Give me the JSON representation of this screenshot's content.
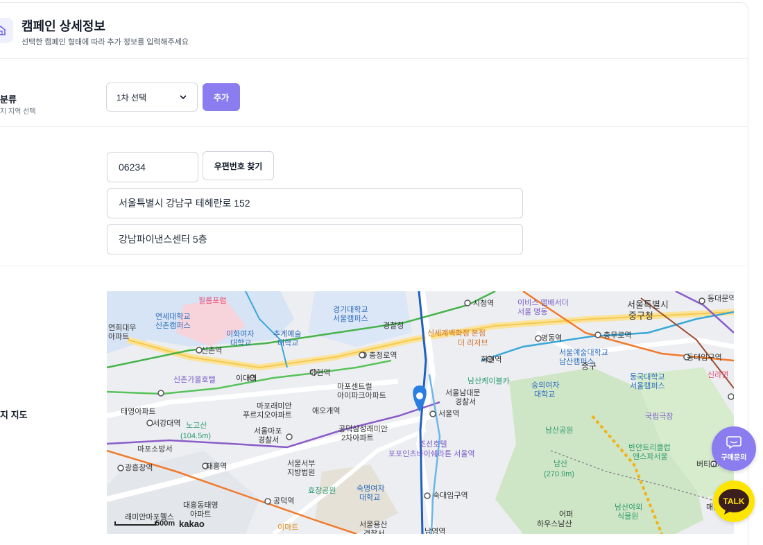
{
  "header": {
    "title": "캠페인 상세정보",
    "subtitle": "선택한 캠페인 형태에 따라 추가 정보를 입력해주세요"
  },
  "region": {
    "label": "분류",
    "hint": "지 지역 선택",
    "select_value": "1차 선택",
    "add_label": "추가"
  },
  "address": {
    "postcode": "06234",
    "find_postcode_label": "우편번호 찾기",
    "address1": "서울특별시 강남구 테헤란로 152",
    "address2": "강남파이낸스센터 5층"
  },
  "map": {
    "label": "지 지도",
    "attribution": "kakao",
    "scale_label": "500m",
    "places": [
      "필름포럼",
      "연세대학교 신촌캠퍼스",
      "이화여자 대학교",
      "추계예술 대학교",
      "경기대학교 서울캠퍼스",
      "경찰청",
      "시청역",
      "이비스 앰배서더 서울 명동",
      "서울특별시 중구청",
      "동대문역",
      "연희대우 아파트",
      "신촌역",
      "충정로역",
      "신세계백화점 본점 더 리저브",
      "명동역",
      "충무로역",
      "서울예술대학교 남산캠퍼스",
      "동대입구역",
      "중구",
      "신촌가올호텔",
      "이대역",
      "아현역",
      "마포센트럴 아이파크아파트",
      "회현역",
      "남산케이블카",
      "숭의여자 대학교",
      "동국대학교 서울캠퍼스",
      "신라면",
      "태영아파트",
      "서강대역",
      "노고산 (104.5m)",
      "마포래미안 푸르지오아파트",
      "애오개역",
      "서울남대문 경찰서",
      "서울역",
      "국립극장",
      "마포소방서",
      "서울마포 경찰서",
      "공덕삼성래미안 2차아파트",
      "조선호텔",
      "포포인츠바이쉐라톤 서울역",
      "남산공원",
      "반얀트리클럽 앤스파서울",
      "광흥창역",
      "대흥역",
      "서울서부 지방법원",
      "남산 (270.9m)",
      "버티고개",
      "효창공원",
      "숙명여자 대학교",
      "숙대입구역",
      "대흥동태영 아파트",
      "공덕역",
      "이마트",
      "서울용산 경찰서",
      "어퍼",
      "하우스남산",
      "남산야외 식물원",
      "래미안마포웰스",
      "남영역",
      "매봉"
    ]
  },
  "fab": {
    "chat_label": "구매문의",
    "talk_label": "TALK"
  },
  "colors": {
    "accent": "#8b7cf0",
    "kakao": "#fee500"
  }
}
